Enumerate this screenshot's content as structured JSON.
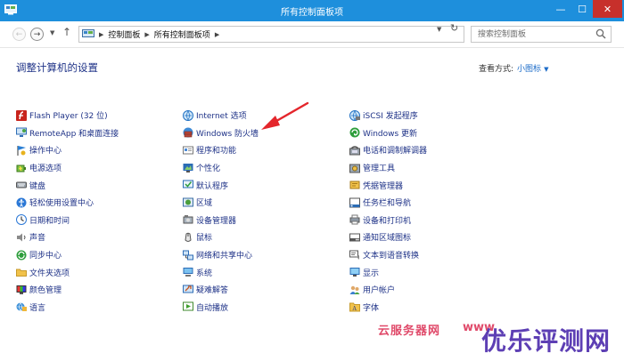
{
  "window": {
    "title": "所有控制面板项",
    "minimize_glyph": "—",
    "maximize_glyph": "☐",
    "close_glyph": "✕"
  },
  "nav": {
    "back_glyph": "←",
    "forward_glyph": "→",
    "dropdown_glyph": "▼",
    "up_glyph": "↑",
    "breadcrumb": [
      "控制面板",
      "所有控制面板项"
    ],
    "separator_glyph": "▶",
    "address_dropdown_glyph": "▼",
    "refresh_glyph": "↻",
    "search_placeholder": "搜索控制面板"
  },
  "main": {
    "heading": "调整计算机的设置",
    "view_by_label": "查看方式:",
    "view_by_value": "小图标",
    "view_by_caret": "▼"
  },
  "items": [
    [
      {
        "label": "Flash Player (32 位)",
        "icon": "flash-icon"
      },
      {
        "label": "RemoteApp 和桌面连接",
        "icon": "remoteapp-icon"
      },
      {
        "label": "操作中心",
        "icon": "action-center-icon"
      },
      {
        "label": "电源选项",
        "icon": "power-options-icon"
      },
      {
        "label": "键盘",
        "icon": "keyboard-icon"
      },
      {
        "label": "轻松使用设置中心",
        "icon": "ease-of-access-icon"
      },
      {
        "label": "日期和时间",
        "icon": "date-time-icon"
      },
      {
        "label": "声音",
        "icon": "sound-icon"
      },
      {
        "label": "同步中心",
        "icon": "sync-center-icon"
      },
      {
        "label": "文件夹选项",
        "icon": "folder-options-icon"
      },
      {
        "label": "颜色管理",
        "icon": "color-management-icon"
      },
      {
        "label": "语言",
        "icon": "language-icon"
      }
    ],
    [
      {
        "label": "Internet 选项",
        "icon": "internet-options-icon"
      },
      {
        "label": "Windows 防火墙",
        "icon": "firewall-icon"
      },
      {
        "label": "程序和功能",
        "icon": "programs-features-icon"
      },
      {
        "label": "个性化",
        "icon": "personalization-icon"
      },
      {
        "label": "默认程序",
        "icon": "default-programs-icon"
      },
      {
        "label": "区域",
        "icon": "region-icon"
      },
      {
        "label": "设备管理器",
        "icon": "device-manager-icon"
      },
      {
        "label": "鼠标",
        "icon": "mouse-icon"
      },
      {
        "label": "网络和共享中心",
        "icon": "network-sharing-icon"
      },
      {
        "label": "系统",
        "icon": "system-icon"
      },
      {
        "label": "疑难解答",
        "icon": "troubleshooting-icon"
      },
      {
        "label": "自动播放",
        "icon": "autoplay-icon"
      }
    ],
    [
      {
        "label": "iSCSI 发起程序",
        "icon": "iscsi-icon"
      },
      {
        "label": "Windows 更新",
        "icon": "windows-update-icon"
      },
      {
        "label": "电话和调制解调器",
        "icon": "phone-modem-icon"
      },
      {
        "label": "管理工具",
        "icon": "admin-tools-icon"
      },
      {
        "label": "凭据管理器",
        "icon": "credential-manager-icon"
      },
      {
        "label": "任务栏和导航",
        "icon": "taskbar-icon"
      },
      {
        "label": "设备和打印机",
        "icon": "devices-printers-icon"
      },
      {
        "label": "通知区域图标",
        "icon": "notification-icons-icon"
      },
      {
        "label": "文本到语音转换",
        "icon": "text-to-speech-icon"
      },
      {
        "label": "显示",
        "icon": "display-icon"
      },
      {
        "label": "用户帐户",
        "icon": "user-accounts-icon"
      },
      {
        "label": "字体",
        "icon": "fonts-icon"
      }
    ]
  ],
  "watermark": {
    "left_text": "云服务器网",
    "middle_text": "www",
    "right_text": "优乐评测网"
  },
  "colors": {
    "titlebar": "#1e8fdc",
    "close_button": "#c7302b",
    "link_text": "#1e3287",
    "annotation_arrow": "#e4262c"
  }
}
